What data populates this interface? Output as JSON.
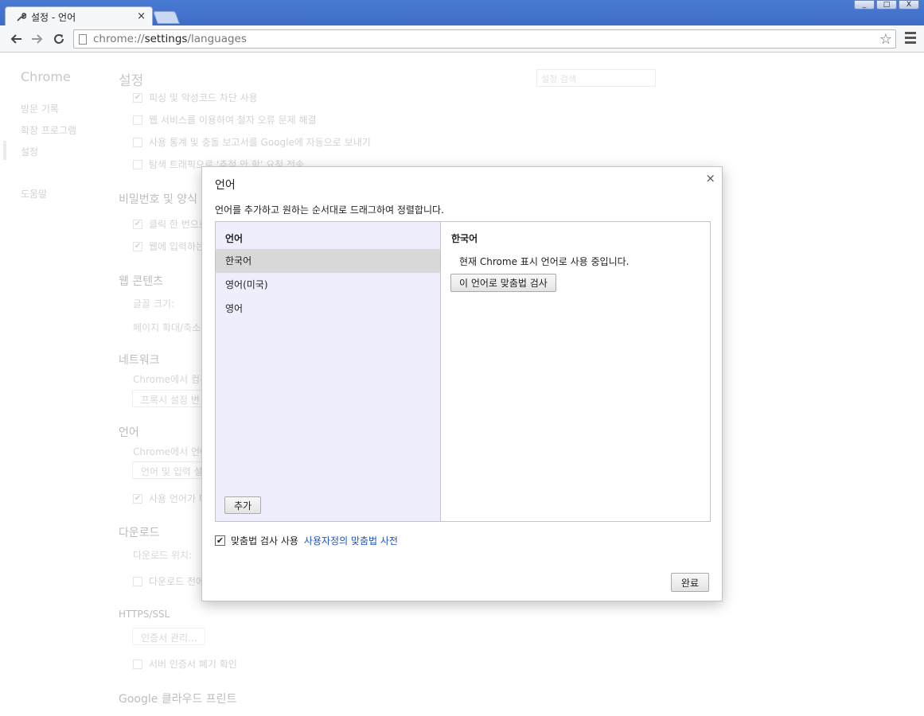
{
  "window": {
    "tab_title": "설정 - 언어",
    "tab_close": "×",
    "controls": [
      "_",
      "□",
      "X"
    ]
  },
  "toolbar": {
    "url_prefix": "chrome://",
    "url_host": "settings",
    "url_path": "/languages"
  },
  "sidebar": {
    "brand": "Chrome",
    "items": [
      {
        "label": "방문 기록"
      },
      {
        "label": "확장 프로그램"
      },
      {
        "label": "설정"
      },
      {
        "label": "도움말"
      }
    ]
  },
  "settings": {
    "title": "설정",
    "search_placeholder": "설정 검색",
    "privacy_rows": [
      "피싱 및 악성코드 차단 사용",
      "웹 서비스를 이용하여 철자 오류 문제 해결",
      "사용 통계 및 충돌 보고서를 Google에 자동으로 보내기",
      "탐색 트래픽으로 '추적 안 함' 요청 전송"
    ],
    "password_heading": "비밀번호 및 양식",
    "password_rows": [
      "클릭 한 번으로",
      "웹에 입력하는"
    ],
    "web_content_heading": "웹 콘텐츠",
    "font_size_label": "글꼴 크기:",
    "page_zoom_label": "페이지 확대/축소",
    "network_heading": "네트워크",
    "network_text": "Chrome에서 컴퓨",
    "proxy_button": "프록시 설정 변",
    "language_heading": "언어",
    "language_text": "Chrome에서 언어",
    "language_button": "언어 및 입력 설",
    "language_check": "사용 언어가 다",
    "download_heading": "다운로드",
    "download_location": "다운로드 위치:",
    "download_check": "다운로드 전에",
    "https_heading": "HTTPS/SSL",
    "cert_button": "인증서 관리...",
    "cert_check": "서버 인증서 폐기 확인",
    "cloud_print_heading": "Google 클라우드 프린트"
  },
  "dialog": {
    "title": "언어",
    "close": "×",
    "description": "언어를 추가하고 원하는 순서대로 드래그하여 정렬합니다.",
    "list_header": "언어",
    "languages": [
      "한국어",
      "영어(미국)",
      "영어"
    ],
    "selected_index": 0,
    "add_button": "추가",
    "detail_title": "한국어",
    "detail_text": "현재 Chrome 표시 언어로 사용 중입니다.",
    "spellcheck_button": "이 언어로 맞춤법 검사",
    "spellcheck_enabled_label": "맞춤법 검사 사용",
    "spellcheck_enabled": true,
    "custom_dictionary_link": "사용자정의 맞춤법 사전",
    "done_button": "완료"
  }
}
